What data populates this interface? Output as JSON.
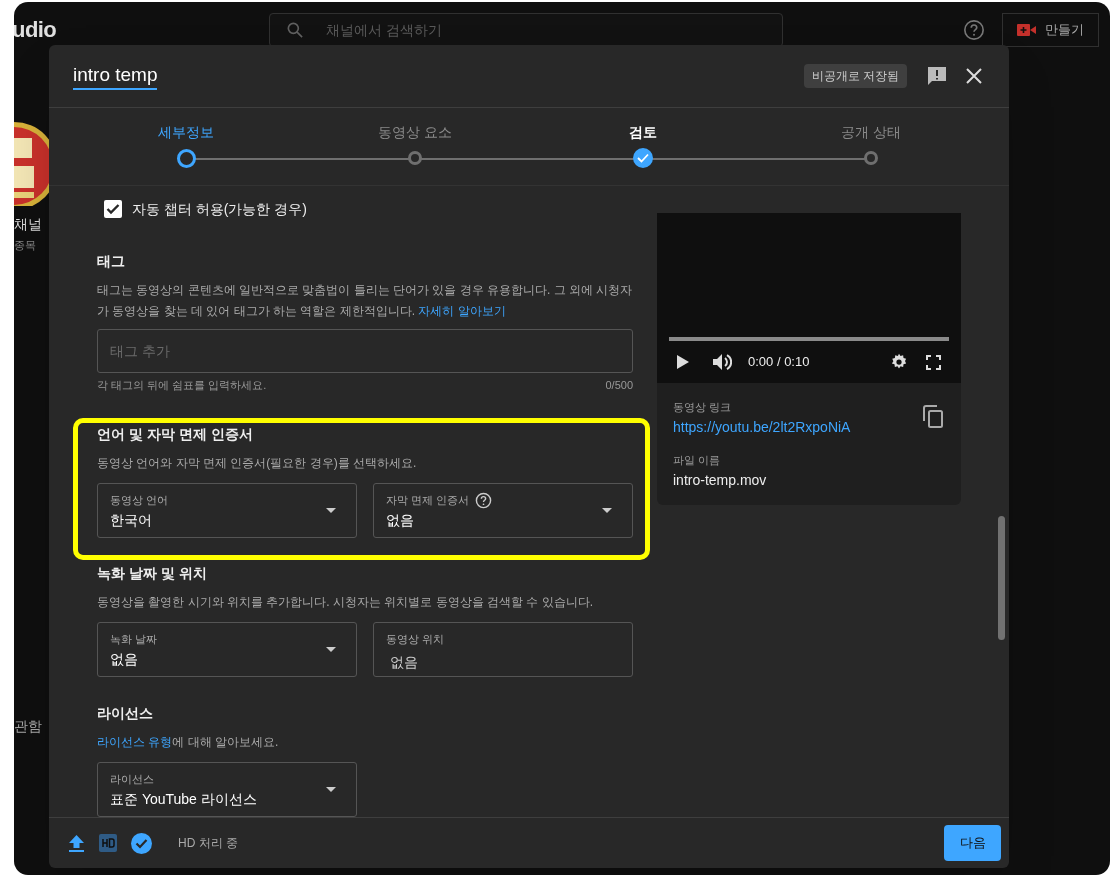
{
  "app": {
    "logo": "udio",
    "search": {
      "placeholder": "채널에서 검색하기"
    },
    "create_button": "만들기",
    "sidebar": {
      "channel_label": "채널",
      "channel_sub": "종목",
      "nav_item": "관함"
    }
  },
  "dialog": {
    "title": "intro temp",
    "save_status": "비공개로 저장됨",
    "steps": [
      {
        "label": "세부정보",
        "kind": "current"
      },
      {
        "label": "동영상 요소",
        "kind": "pending"
      },
      {
        "label": "검토",
        "kind": "done"
      },
      {
        "label": "공개 상태",
        "kind": "pending"
      }
    ],
    "auto_chapters": {
      "label": "자동 챕터 허용(가능한 경우)",
      "checked": true
    },
    "tags": {
      "heading": "태그",
      "description": "태그는 동영상의 콘텐츠에 일반적으로 맞춤법이 틀리는 단어가 있을 경우 유용합니다. 그 외에 시청자가 동영상을 찾는 데 있어 태그가 하는 역할은 제한적입니다.",
      "link": "자세히 알아보기",
      "placeholder": "태그 추가",
      "hint": "각 태그의 뒤에 쉼표를 입력하세요.",
      "count": "0/500"
    },
    "language": {
      "heading": "언어 및 자막 면제 인증서",
      "description": "동영상 언어와 자막 면제 인증서(필요한 경우)를 선택하세요.",
      "fields": [
        {
          "kind": "dropdown",
          "label": "동영상 언어",
          "value": "한국어",
          "help": false
        },
        {
          "kind": "dropdown",
          "label": "자막 면제 인증서",
          "value": "없음",
          "help": true
        }
      ]
    },
    "recording": {
      "heading": "녹화 날짜 및 위치",
      "description": "동영상을 촬영한 시기와 위치를 추가합니다. 시청자는 위치별로 동영상을 검색할 수 있습니다.",
      "fields": [
        {
          "kind": "dropdown",
          "label": "녹화 날짜",
          "value": "없음"
        },
        {
          "kind": "text",
          "label": "동영상 위치",
          "value": "없음"
        }
      ]
    },
    "license": {
      "heading": "라이선스",
      "link": "라이선스 유형",
      "description": "에 대해 알아보세요.",
      "fields": [
        {
          "kind": "dropdown",
          "label": "라이선스",
          "value": "표준 YouTube 라이선스"
        }
      ]
    },
    "preview": {
      "progress": {
        "level": 0
      },
      "time": "0:00 / 0:10",
      "link_label": "동영상 링크",
      "link": "https://youtu.be/2lt2RxpoNiA",
      "file_label": "파일 이름",
      "file_name": "intro-temp.mov"
    },
    "footer": {
      "status": "HD 처리 중",
      "next_button": "다음"
    }
  }
}
